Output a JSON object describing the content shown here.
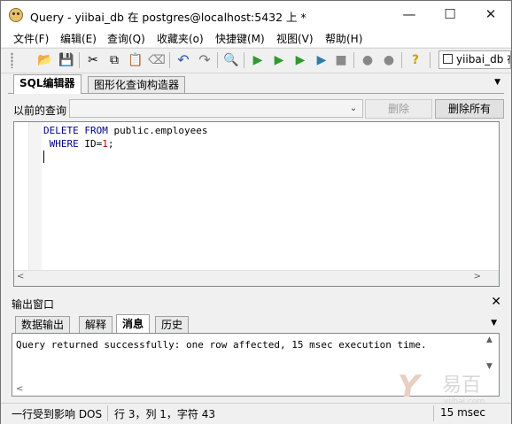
{
  "window": {
    "title": "Query - yiibai_db 在  postgres@localhost:5432 上 *",
    "minimize_icon": "minimize-icon",
    "maximize_icon": "maximize-icon",
    "close_icon": "close-icon"
  },
  "menu": {
    "items": [
      {
        "label": "文件(F)"
      },
      {
        "label": "编辑(E)"
      },
      {
        "label": "查询(Q)"
      },
      {
        "label": "收藏夹(o)"
      },
      {
        "label": "快捷键(M)"
      },
      {
        "label": "视图(V)"
      },
      {
        "label": "帮助(H)"
      }
    ]
  },
  "toolbar": {
    "icons": [
      {
        "name": "open-folder-icon",
        "glyph": "📂"
      },
      {
        "name": "save-icon",
        "glyph": "💾"
      },
      {
        "name": "cut-icon",
        "glyph": "✂"
      },
      {
        "name": "copy-icon",
        "glyph": "⧉"
      },
      {
        "name": "paste-icon",
        "glyph": "📋"
      },
      {
        "name": "eraser-icon",
        "glyph": "⌫"
      },
      {
        "name": "undo-icon",
        "glyph": "↶"
      },
      {
        "name": "redo-icon",
        "glyph": "↷"
      },
      {
        "name": "find-icon",
        "glyph": "🔍"
      },
      {
        "name": "execute-icon",
        "glyph": "▶"
      },
      {
        "name": "execute-pgscript-icon",
        "glyph": "▶"
      },
      {
        "name": "execute-to-file-icon",
        "glyph": "▶"
      },
      {
        "name": "explain-icon",
        "glyph": "▶"
      },
      {
        "name": "stop-icon",
        "glyph": "■"
      },
      {
        "name": "commit-icon",
        "glyph": "●"
      },
      {
        "name": "rollback-icon",
        "glyph": "●"
      },
      {
        "name": "help-icon",
        "glyph": "?"
      }
    ],
    "database": "yiibai_db 在"
  },
  "editor_tabs": [
    {
      "label": "SQL编辑器",
      "active": true
    },
    {
      "label": "图形化查询构造器",
      "active": false
    }
  ],
  "previous_queries": {
    "label": "以前的查询",
    "value": "",
    "delete_label": "删除",
    "delete_all_label": "删除所有"
  },
  "sql": {
    "line1_kw1": "DELETE",
    "line1_kw2": "FROM",
    "line1_rest": " public.employees",
    "line2_kw": "WHERE",
    "line2_mid": " ID=",
    "line2_num": "1",
    "line2_end": ";"
  },
  "output": {
    "title": "输出窗口",
    "tabs": [
      {
        "label": "数据输出",
        "active": false
      },
      {
        "label": "解释",
        "active": false
      },
      {
        "label": "消息",
        "active": true
      },
      {
        "label": "历史",
        "active": false
      }
    ],
    "message": "Query returned successfully: one row affected, 15 msec execution time."
  },
  "status": {
    "rows": "一行受到影响 DOS",
    "position": "行 3，列 1，字符 43",
    "time": "15 msec"
  },
  "watermark": {
    "brand": "易百",
    "site": "yiibai.com"
  },
  "colors": {
    "keyword": "#00008b",
    "number": "#c00000",
    "play_green": "#2e9b2e"
  }
}
